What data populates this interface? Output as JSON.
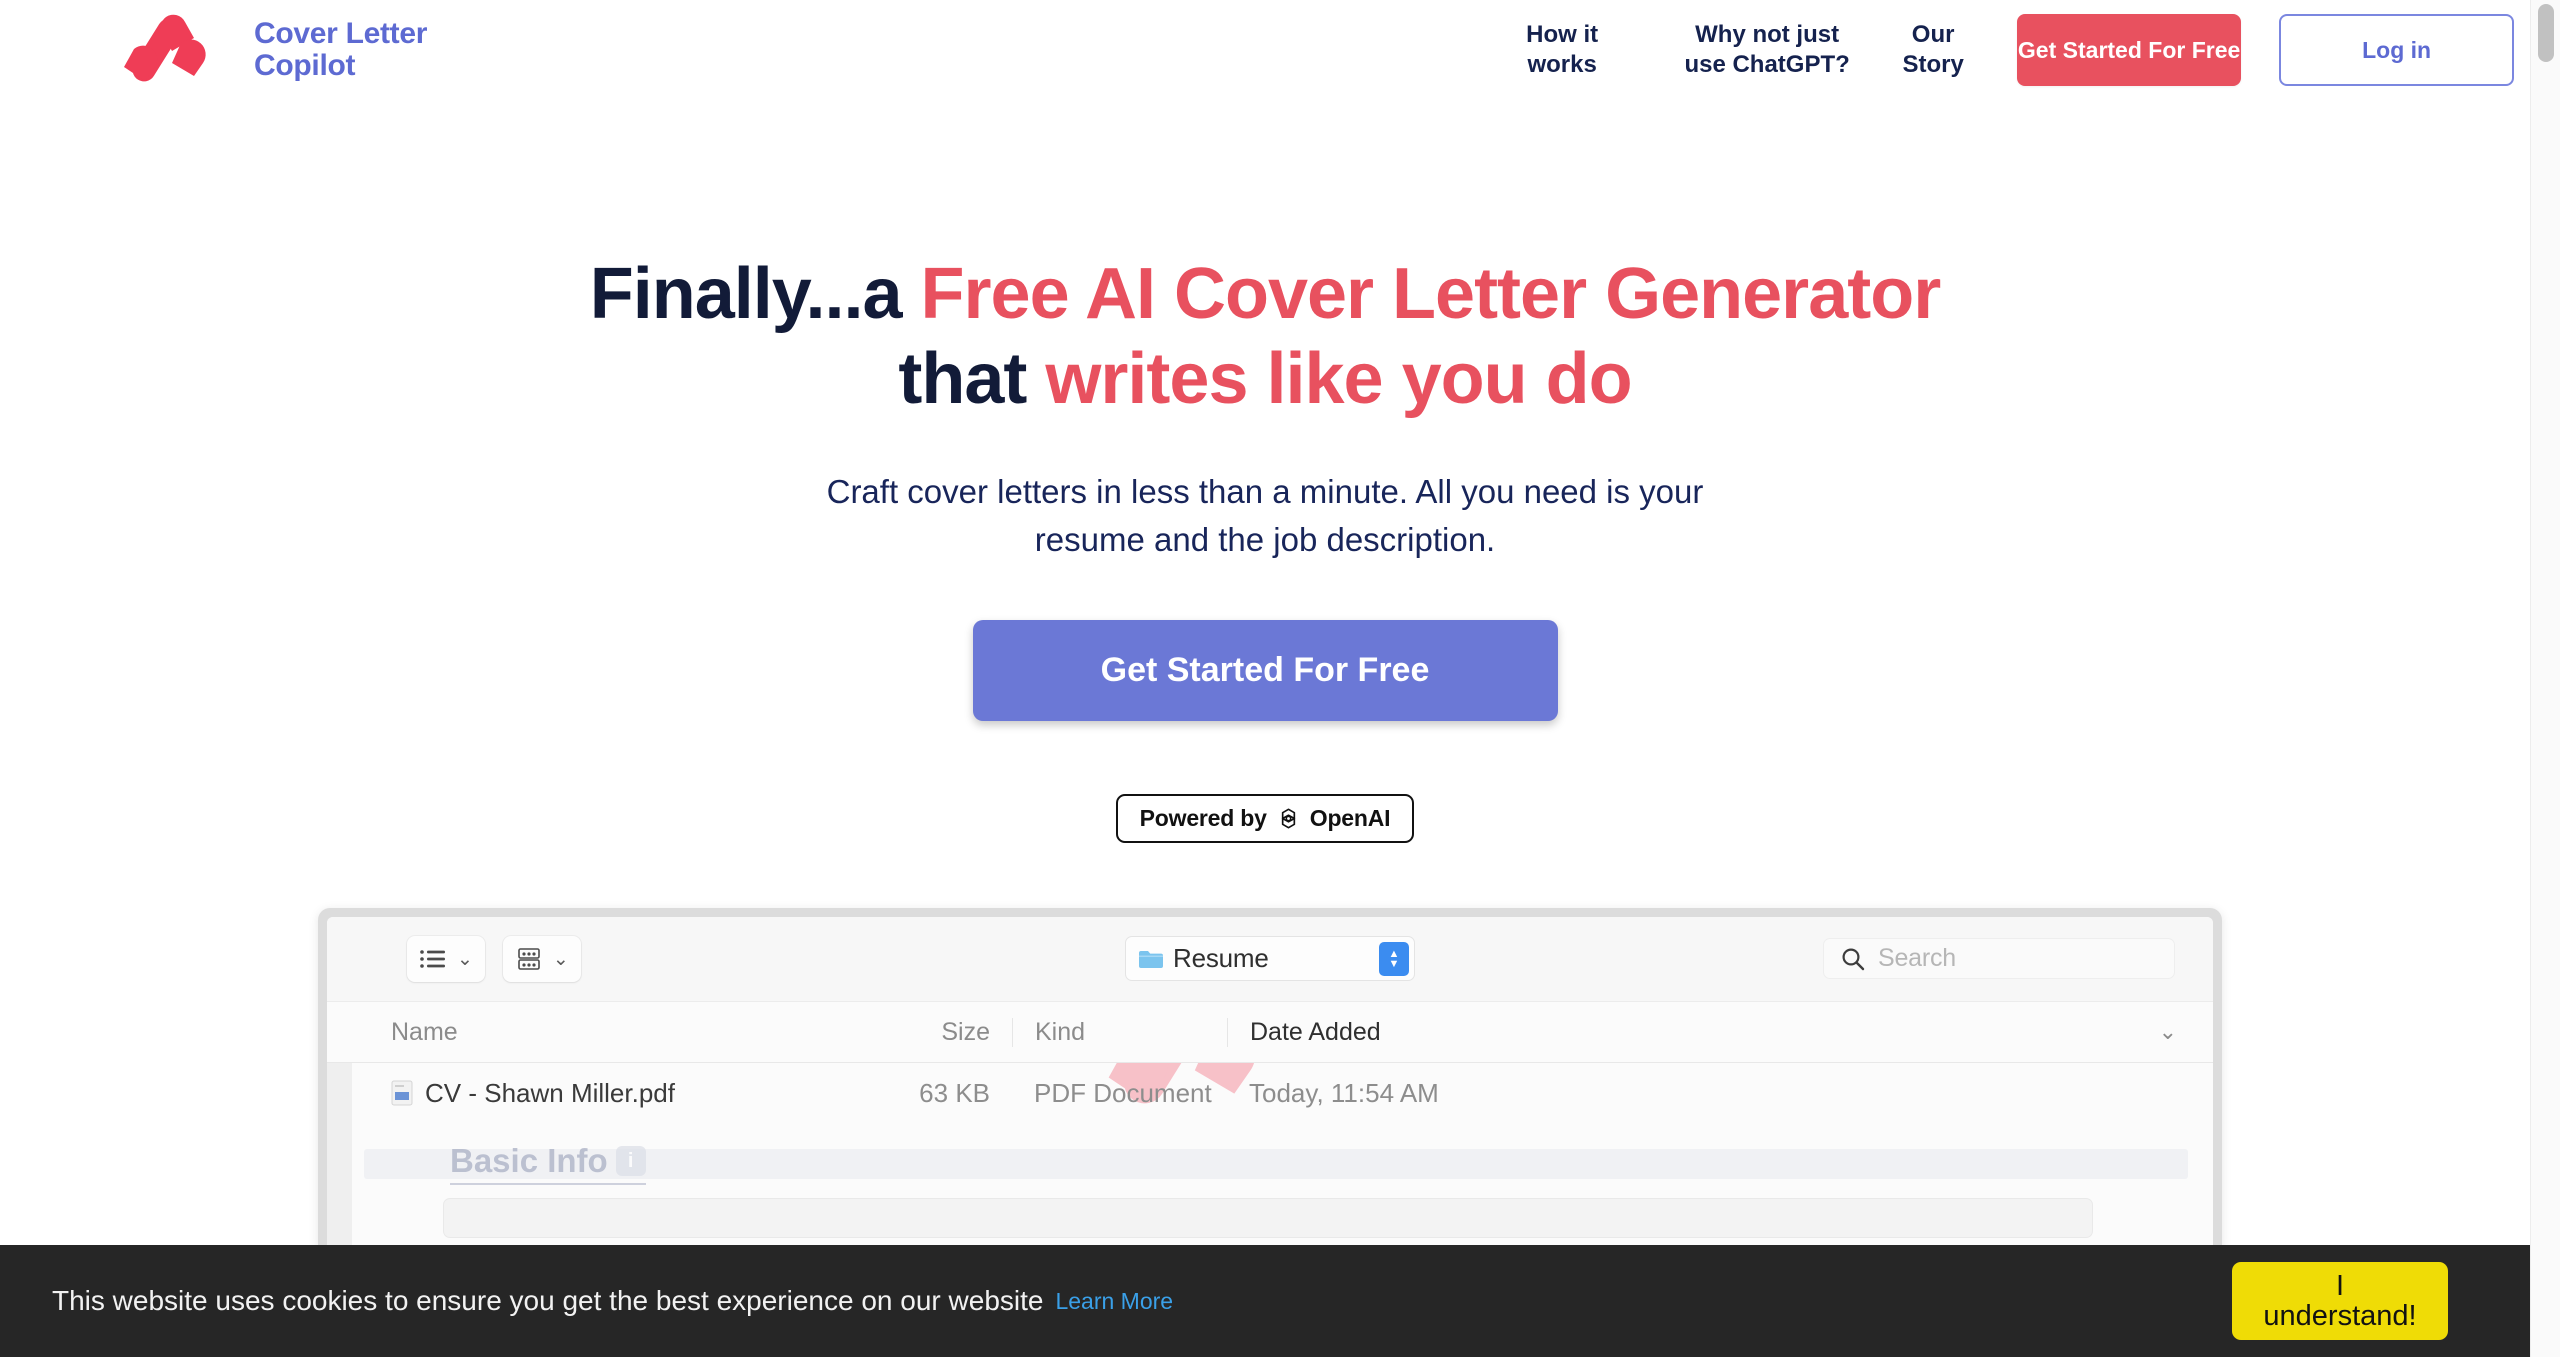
{
  "brand": {
    "name_line1": "Cover Letter",
    "name_line2": "Copilot",
    "logo_icon": "coverlettercopilot-logo-icon",
    "color": "#5d6ad2",
    "mark_color": "#ef3d56"
  },
  "nav": {
    "links": [
      {
        "label": "How it works"
      },
      {
        "label": "Why not just use ChatGPT?"
      },
      {
        "label": "Our Story"
      }
    ],
    "cta_label": "Get Started For Free",
    "login_label": "Log in",
    "cta_color": "#e8515f",
    "login_border_color": "#7b87e0"
  },
  "hero": {
    "headline_part1": "Finally...a ",
    "headline_accent1": "Free AI Cover Letter Generator",
    "headline_part2": "that ",
    "headline_accent2": "writes like you do",
    "subhead_line1": "Craft cover letters in less than a minute. All you need is your",
    "subhead_line2": "resume and the job description.",
    "cta_label": "Get Started For Free",
    "cta_color": "#6b78d6",
    "accent_color": "#e8515f",
    "heading_color": "#121b38"
  },
  "openai_badge": {
    "text": "Powered by",
    "brand": "OpenAI",
    "icon": "openai-logo-icon"
  },
  "finder": {
    "view_icon": "list-view-icon",
    "group_icon": "group-view-icon",
    "chevron_icon": "chevron-down-icon",
    "folder_icon": "folder-icon",
    "path_label": "Resume",
    "stepper_icon": "stepper-up-down-icon",
    "search_icon": "search-icon",
    "search_placeholder": "Search",
    "columns": [
      "Name",
      "Size",
      "Kind",
      "Date Added"
    ],
    "sort_chevron_icon": "chevron-down-icon",
    "rows": [
      {
        "icon": "pdf-file-icon",
        "name": "CV - Shawn Miller.pdf",
        "size": "63 KB",
        "kind": "PDF Document",
        "date": "Today, 11:54 AM"
      }
    ],
    "overlay_label": "Basic Info",
    "overlay_badge": "i",
    "watermark_icon": "brand-watermark-icon"
  },
  "cookie": {
    "message": "This website uses cookies to ensure you get the best experience on our website",
    "link_label": "Learn More",
    "button_line1": "I",
    "button_line2": "understand!",
    "button_color": "#efdc06",
    "background": "#262626",
    "link_color": "#3aa0e8"
  },
  "scrollbar": {
    "thumb_name": "vertical-scroll-thumb"
  }
}
